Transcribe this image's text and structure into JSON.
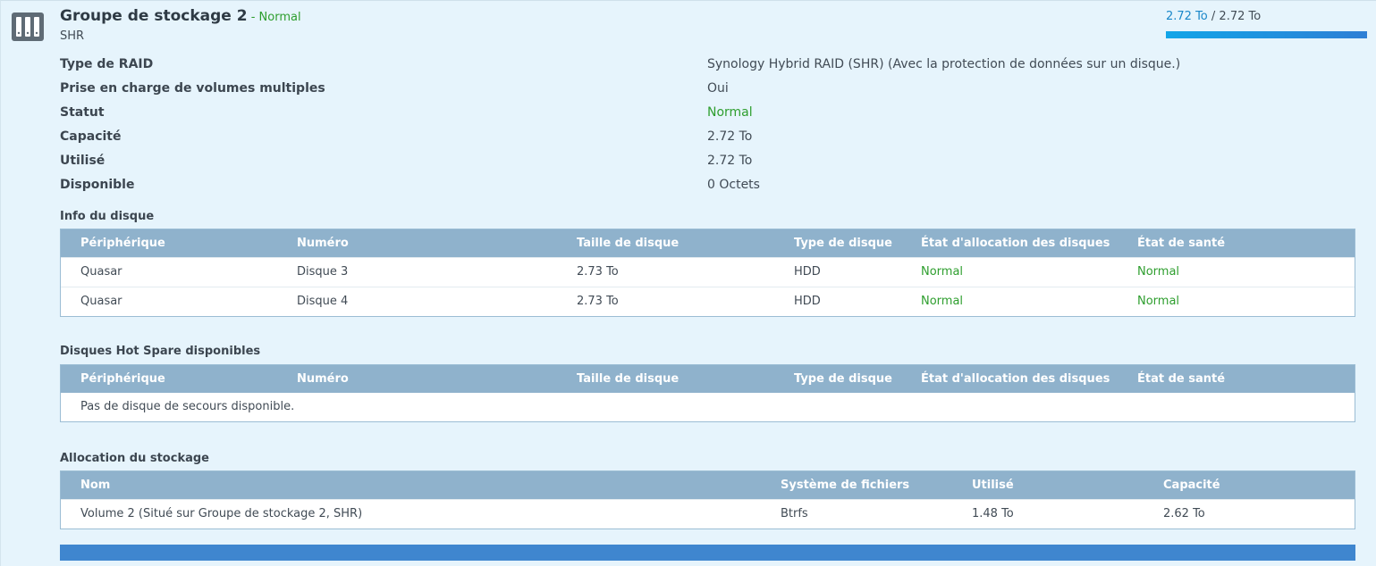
{
  "pool": {
    "title": "Groupe de stockage 2",
    "separator": " - ",
    "status": "Normal",
    "subtitle": "SHR",
    "icon": "storage-pool-icon",
    "usage_used": "2.72 To",
    "usage_slash": " / ",
    "usage_total": "2.72 To",
    "usage_fraction": 1.0,
    "status_color": "#2e9e2e",
    "accent_color": "#1a87c9"
  },
  "props": [
    {
      "label": "Type de RAID",
      "value": "Synology Hybrid RAID (SHR) (Avec la protection de données sur un disque.)"
    },
    {
      "label": "Prise en charge de volumes multiples",
      "value": "Oui"
    },
    {
      "label": "Statut",
      "value": "Normal"
    },
    {
      "label": "Capacité",
      "value": "2.72 To"
    },
    {
      "label": "Utilisé",
      "value": "2.72 To"
    },
    {
      "label": "Disponible",
      "value": "0 Octets"
    }
  ],
  "disk_info": {
    "title": "Info du disque",
    "columns": [
      "Périphérique",
      "Numéro",
      "Taille de disque",
      "Type de disque",
      "État d'allocation des disques",
      "État de santé"
    ],
    "rows": [
      [
        "Quasar",
        "Disque 3",
        "2.73 To",
        "HDD",
        "Normal",
        "Normal"
      ],
      [
        "Quasar",
        "Disque 4",
        "2.73 To",
        "HDD",
        "Normal",
        "Normal"
      ]
    ]
  },
  "hot_spare": {
    "title": "Disques Hot Spare disponibles",
    "columns": [
      "Périphérique",
      "Numéro",
      "Taille de disque",
      "Type de disque",
      "État d'allocation des disques",
      "État de santé"
    ],
    "empty_text": "Pas de disque de secours disponible."
  },
  "allocation": {
    "title": "Allocation du stockage",
    "columns": [
      "Nom",
      "Système de fichiers",
      "Utilisé",
      "Capacité"
    ],
    "rows": [
      [
        "Volume 2 (Situé sur Groupe de stockage 2, SHR)",
        "Btrfs",
        "1.48 To",
        "2.62 To"
      ]
    ]
  }
}
